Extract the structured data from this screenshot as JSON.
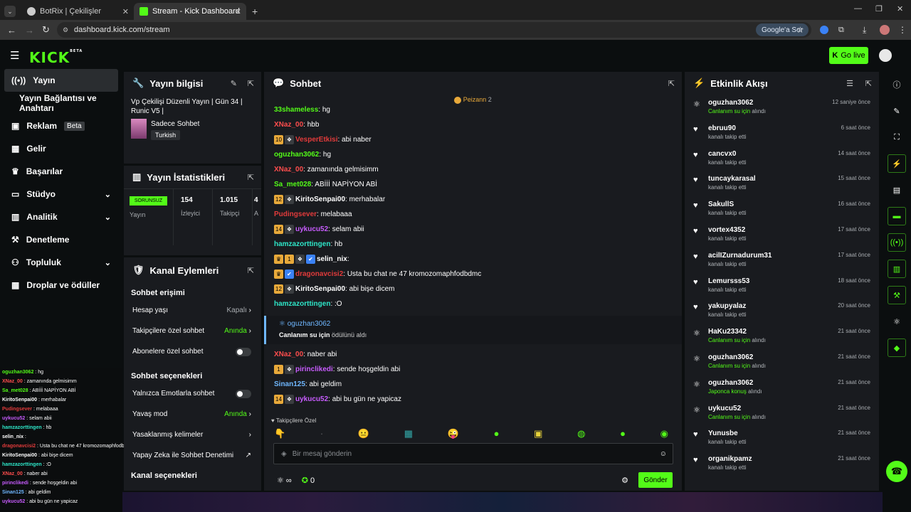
{
  "browser": {
    "tabs": [
      {
        "title": "BotRix | Çekilişler",
        "fav_color": "#cccccc"
      },
      {
        "title": "Stream - Kick Dashboard",
        "fav_color": "#53fc18"
      }
    ],
    "url": "dashboard.kick.com/stream",
    "google_btn": "Google'a Sor"
  },
  "header": {
    "logo": "KICK",
    "beta": "BETA",
    "go_live": "Go live"
  },
  "sidebar": {
    "items": [
      {
        "label": "Yayın",
        "icon": "▣"
      },
      {
        "label": "Yayın Bağlantısı ve Anahtarı",
        "icon": ""
      },
      {
        "label": "Reklam",
        "icon": "▤",
        "badge": "Beta"
      },
      {
        "label": "Gelir",
        "icon": "▦"
      },
      {
        "label": "Başarılar",
        "icon": "🏆"
      },
      {
        "label": "Stüdyo",
        "icon": "▭",
        "chev": "⌄"
      },
      {
        "label": "Analitik",
        "icon": "▥",
        "chev": "⌄"
      },
      {
        "label": "Denetleme",
        "icon": "⚒"
      },
      {
        "label": "Topluluk",
        "icon": "👥",
        "chev": "⌄"
      },
      {
        "label": "Droplar ve ödüller",
        "icon": "▦"
      }
    ]
  },
  "stream_info": {
    "title": "Yayın bilgisi",
    "stream_title": "Vp Çekilişi Düzenli Yayın | Gün 34 | Runic V5 |",
    "category": "Sadece Sohbet",
    "language": "Turkish"
  },
  "stats": {
    "title": "Yayın İstatistikleri",
    "status": "SORUNSUZ",
    "status_label": "Yayın",
    "viewers": "154",
    "viewers_label": "İzleyici",
    "followers": "1.015",
    "followers_label": "Takipçi",
    "extra": "4",
    "extra_label": "A"
  },
  "channel_actions": {
    "title": "Kanal Eylemleri",
    "section1": "Sohbet erişimi",
    "rows": [
      {
        "label": "Hesap yaşı",
        "value": "Kapalı",
        "chev": "›"
      },
      {
        "label": "Takipçilere özel sohbet",
        "value": "Anında",
        "chev": "›"
      },
      {
        "label": "Abonelere özel sohbet",
        "value": ""
      }
    ],
    "section2": "Sohbet seçenekleri",
    "rows2": [
      {
        "label": "Yalnızca Emotlarla sohbet",
        "value": ""
      },
      {
        "label": "Yavaş mod",
        "value": "Anında",
        "chev": "›"
      },
      {
        "label": "Yasaklanmış kelimeler",
        "value": "",
        "chev": "›"
      },
      {
        "label": "Yapay Zeka ile Sohbet Denetimi",
        "value": "↗"
      }
    ],
    "section3": "Kanal seçenekleri"
  },
  "chat": {
    "title": "Sohbet",
    "pinned_user": "Peizann",
    "pinned_count": "2",
    "messages": [
      {
        "user": "33shameless",
        "text": "hg",
        "color": "#53fc18",
        "badges": []
      },
      {
        "user": "XNaz_00",
        "text": "hbb",
        "color": "#ff4d4d",
        "badges": []
      },
      {
        "user": "VesperEtkisi",
        "text": "abi naber",
        "color": "#e23b3b",
        "badges": [
          "10",
          "s"
        ]
      },
      {
        "user": "oguzhan3062",
        "text": "hg",
        "color": "#53fc18",
        "badges": []
      },
      {
        "user": "XNaz_00",
        "text": "zamanında gelmisimm",
        "color": "#ff4d4d",
        "badges": []
      },
      {
        "user": "Sa_met028",
        "text": "ABİİİ NAPİYON ABİ",
        "color": "#53fc18",
        "badges": []
      },
      {
        "user": "KiritoSenpai00",
        "text": "merhabalar",
        "color": "#ffffff",
        "badges": [
          "12",
          "s"
        ]
      },
      {
        "user": "Pudingsever",
        "text": "melabaaa",
        "color": "#e23b3b",
        "badges": []
      },
      {
        "user": "uykucu52",
        "text": "selam abii",
        "color": "#c85cff",
        "badges": [
          "14",
          "s"
        ]
      },
      {
        "user": "hamzazorttingen",
        "text": "hb",
        "color": "#2ee6c8",
        "badges": []
      },
      {
        "user": "selin_nix",
        "text": "",
        "color": "#ffffff",
        "badges": [
          "c",
          "1",
          "s",
          "v"
        ]
      },
      {
        "user": "dragonavcisi2",
        "text": "Usta bu chat ne 47 kromozomaphfodbdmc",
        "color": "#e23b3b",
        "badges": [
          "c",
          "v"
        ]
      },
      {
        "user": "KiritoSenpai00",
        "text": "abi bişe dicem",
        "color": "#ffffff",
        "badges": [
          "12",
          "s"
        ]
      },
      {
        "user": "hamzazorttingen",
        "text": ":O",
        "color": "#2ee6c8",
        "badges": []
      }
    ],
    "reward": {
      "user": "oguzhan3062",
      "text_pre": "Canlanım su için",
      "text_post": "ödülünü aldı"
    },
    "messages2": [
      {
        "user": "XNaz_00",
        "text": "naber abi",
        "color": "#ff4d4d",
        "badges": []
      },
      {
        "user": "pirinclikedi",
        "text": "sende hoşgeldin abi",
        "color": "#c85cff",
        "badges": [
          "1",
          "s"
        ]
      },
      {
        "user": "Sinan125",
        "text": "abi geldim",
        "color": "#6fb7ff",
        "badges": []
      },
      {
        "user": "uykucu52",
        "text": "abi bu gün ne yapicaz",
        "color": "#c85cff",
        "badges": [
          "14",
          "s"
        ]
      }
    ],
    "emotes_label": "Takipçilere Özel",
    "input_placeholder": "Bir mesaj gönderin",
    "points": "0",
    "infinity": "∞",
    "send": "Gönder"
  },
  "activity": {
    "title": "Etkinlik Akışı",
    "events": [
      {
        "user": "oguzhan3062",
        "type": "reward",
        "sub_hl": "Canlanım su için",
        "sub": "alındı",
        "time": "12 saniye önce"
      },
      {
        "user": "ebruu90",
        "type": "follow",
        "sub_hl": "",
        "sub": "kanalı takip etti",
        "time": "6 saat önce"
      },
      {
        "user": "cancvx0",
        "type": "follow",
        "sub_hl": "",
        "sub": "kanalı takip etti",
        "time": "14 saat önce"
      },
      {
        "user": "tuncaykarasal",
        "type": "follow",
        "sub_hl": "",
        "sub": "kanalı takip etti",
        "time": "15 saat önce"
      },
      {
        "user": "SakullS",
        "type": "follow",
        "sub_hl": "",
        "sub": "kanalı takip etti",
        "time": "16 saat önce"
      },
      {
        "user": "vortex4352",
        "type": "follow",
        "sub_hl": "",
        "sub": "kanalı takip etti",
        "time": "17 saat önce"
      },
      {
        "user": "acilIZurnadurum31",
        "type": "follow",
        "sub_hl": "",
        "sub": "kanalı takip etti",
        "time": "17 saat önce"
      },
      {
        "user": "Lemursss53",
        "type": "follow",
        "sub_hl": "",
        "sub": "kanalı takip etti",
        "time": "18 saat önce"
      },
      {
        "user": "yakupyalaz",
        "type": "follow",
        "sub_hl": "",
        "sub": "kanalı takip etti",
        "time": "20 saat önce"
      },
      {
        "user": "HaKu23342",
        "type": "reward",
        "sub_hl": "Canlanım su için",
        "sub": "alındı",
        "time": "21 saat önce"
      },
      {
        "user": "oguzhan3062",
        "type": "reward",
        "sub_hl": "Canlanım su için",
        "sub": "alındı",
        "time": "21 saat önce"
      },
      {
        "user": "oguzhan3062",
        "type": "reward",
        "sub_hl": "Japonca konuş",
        "sub": "alındı",
        "time": "21 saat önce"
      },
      {
        "user": "uykucu52",
        "type": "reward",
        "sub_hl": "Canlanım su için",
        "sub": "alındı",
        "time": "21 saat önce"
      },
      {
        "user": "Yunusbe",
        "type": "follow",
        "sub_hl": "",
        "sub": "kanalı takip etti",
        "time": "21 saat önce"
      },
      {
        "user": "organikpamz",
        "type": "follow",
        "sub_hl": "",
        "sub": "kanalı takip etti",
        "time": "21 saat önce"
      }
    ]
  },
  "overlay_chat": [
    {
      "u": "oguzhan3062",
      "t": "hg",
      "c": "#53fc18"
    },
    {
      "u": "XNaz_00",
      "t": "zamanında gelmisimm",
      "c": "#ff4d4d"
    },
    {
      "u": "Sa_met028",
      "t": "ABİİİ NAPİYON ABİ",
      "c": "#53fc18"
    },
    {
      "u": "KiritoSenpai00",
      "t": "merhabalar",
      "c": "#ffffff"
    },
    {
      "u": "Pudingsever",
      "t": "melabaaa",
      "c": "#e23b3b"
    },
    {
      "u": "uykucu52",
      "t": "selam abii",
      "c": "#c85cff"
    },
    {
      "u": "hamzazorttingen",
      "t": "hb",
      "c": "#2ee6c8"
    },
    {
      "u": "selin_nix",
      "t": "",
      "c": "#ffffff"
    },
    {
      "u": "dragonavcisi2",
      "t": "Usta bu chat ne 47 kromozomaphfodbdmc",
      "c": "#e23b3b"
    },
    {
      "u": "KiritoSenpai00",
      "t": "abi bişe dicem",
      "c": "#ffffff"
    },
    {
      "u": "hamzazorttingen",
      "t": ":O",
      "c": "#2ee6c8"
    },
    {
      "u": "XNaz_00",
      "t": "naber abi",
      "c": "#ff4d4d"
    },
    {
      "u": "pirinclikedi",
      "t": "sende hoşgeldin abi",
      "c": "#c85cff"
    },
    {
      "u": "Sinan125",
      "t": "abi geldim",
      "c": "#6fb7ff"
    },
    {
      "u": "uykucu52",
      "t": "abi bu gün ne yapicaz",
      "c": "#c85cff"
    }
  ]
}
